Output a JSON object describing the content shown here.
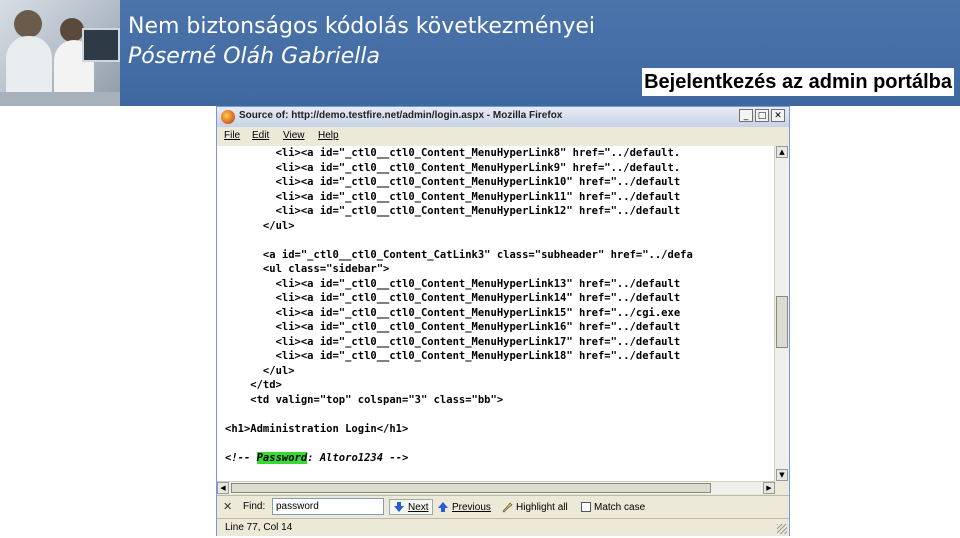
{
  "slide": {
    "title": "Nem biztonságos kódolás következményei",
    "subtitle": "Póserné Oláh Gabriella",
    "section_label": "Bejelentkezés az admin portálba"
  },
  "window": {
    "title": "Source of: http://demo.testfire.net/admin/login.aspx - Mozilla Firefox",
    "min": "_",
    "max": "□",
    "close": "✕"
  },
  "menu": [
    "File",
    "Edit",
    "View",
    "Help"
  ],
  "source_lines": [
    "        <li><a id=\"_ctl0__ctl0_Content_MenuHyperLink8\" href=\"../default.",
    "        <li><a id=\"_ctl0__ctl0_Content_MenuHyperLink9\" href=\"../default.",
    "        <li><a id=\"_ctl0__ctl0_Content_MenuHyperLink10\" href=\"../default",
    "        <li><a id=\"_ctl0__ctl0_Content_MenuHyperLink11\" href=\"../default",
    "        <li><a id=\"_ctl0__ctl0_Content_MenuHyperLink12\" href=\"../default",
    "      </ul>",
    "",
    "      <a id=\"_ctl0__ctl0_Content_CatLink3\" class=\"subheader\" href=\"../defa",
    "      <ul class=\"sidebar\">",
    "        <li><a id=\"_ctl0__ctl0_Content_MenuHyperLink13\" href=\"../default",
    "        <li><a id=\"_ctl0__ctl0_Content_MenuHyperLink14\" href=\"../default",
    "        <li><a id=\"_ctl0__ctl0_Content_MenuHyperLink15\" href=\"../cgi.exe",
    "        <li><a id=\"_ctl0__ctl0_Content_MenuHyperLink16\" href=\"../default",
    "        <li><a id=\"_ctl0__ctl0_Content_MenuHyperLink17\" href=\"../default",
    "        <li><a id=\"_ctl0__ctl0_Content_MenuHyperLink18\" href=\"../default",
    "      </ul>",
    "    </td>",
    "    <td valign=\"top\" colspan=\"3\" class=\"bb\">",
    "",
    "<h1>Administration Login</h1>",
    ""
  ],
  "comment_line": {
    "prefix": "<!-- ",
    "highlight": "Password",
    "suffix": ": Altoro1234 -->"
  },
  "findbar": {
    "close": "✕",
    "label": "Find:",
    "value": "password",
    "next": "Next",
    "previous": "Previous",
    "highlight_all": "Highlight all",
    "match_case": "Match case"
  },
  "status": {
    "text": "Line 77, Col 14"
  },
  "colors": {
    "header_bg": "#4570a8",
    "highlight": "#38d838"
  }
}
